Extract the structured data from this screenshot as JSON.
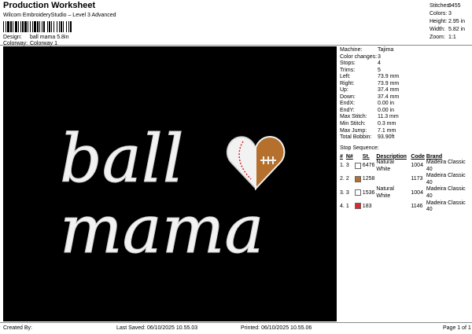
{
  "header": {
    "title": "Production Worksheet",
    "software": "Wilcom EmbroideryStudio – Level 3 Advanced",
    "design_label": "Design:",
    "design_value": "ball mama 5.8in",
    "colorway_label": "Colorway:",
    "colorway_value": "Colorway 1"
  },
  "summary": [
    {
      "label": "Stitches:",
      "value": "9455"
    },
    {
      "label": "Colors:",
      "value": "3"
    },
    {
      "label": "Height:",
      "value": "2.95 in"
    },
    {
      "label": "Width:",
      "value": "5.82 in"
    },
    {
      "label": "Zoom:",
      "value": "1:1"
    }
  ],
  "design_artwork": {
    "background": "#000000",
    "thread_color": "#f2f2f2",
    "line1": "ball",
    "line2": "mama",
    "heart_left_color": "#f2f2f2",
    "heart_right_color": "#b5702e",
    "heart_stitch_color": "#d8292e"
  },
  "params": [
    {
      "label": "Machine:",
      "value": "Tajima"
    },
    {
      "label": "Color changes:",
      "value": "3"
    },
    {
      "label": "Stops:",
      "value": "4"
    },
    {
      "label": "Trims:",
      "value": "5"
    },
    {
      "label": "Left:",
      "value": "73.9 mm"
    },
    {
      "label": "Right:",
      "value": "73.9 mm"
    },
    {
      "label": "Up:",
      "value": "37.4 mm"
    },
    {
      "label": "Down:",
      "value": "37.4 mm"
    },
    {
      "label": "EndX:",
      "value": "0.00 in"
    },
    {
      "label": "EndY:",
      "value": "0.00 in"
    },
    {
      "label": "Max Stitch:",
      "value": "11.3 mm"
    },
    {
      "label": "Min Stitch:",
      "value": "0.3 mm"
    },
    {
      "label": "Max Jump:",
      "value": "7.1 mm"
    },
    {
      "label": "Total Bobbin:",
      "value": "93.90ft"
    }
  ],
  "stop_sequence": {
    "title": "Stop Sequence:",
    "headers": [
      "#",
      "N#",
      "St.",
      "Description",
      "Code",
      "Brand"
    ],
    "rows": [
      {
        "num": "1.",
        "n": "3",
        "color": "#ffffff",
        "st": "6476",
        "desc": "Natural White",
        "code": "1004",
        "brand": "Madeira Classic 40"
      },
      {
        "num": "2.",
        "n": "2",
        "color": "#b5702e",
        "st": "1258",
        "desc": "",
        "code": "1173",
        "brand": "Madeira Classic 40"
      },
      {
        "num": "3.",
        "n": "3",
        "color": "#ffffff",
        "st": "1536",
        "desc": "Natural White",
        "code": "1004",
        "brand": "Madeira Classic 40"
      },
      {
        "num": "4.",
        "n": "1",
        "color": "#d8292e",
        "st": "183",
        "desc": "",
        "code": "1146",
        "brand": "Madeira Classic 40"
      }
    ]
  },
  "footer": {
    "created_by": "Created By:",
    "last_saved": "Last Saved: 06/10/2025 10.55.03",
    "printed": "Printed: 06/10/2025 10.55.06",
    "page": "Page 1 of 1"
  }
}
